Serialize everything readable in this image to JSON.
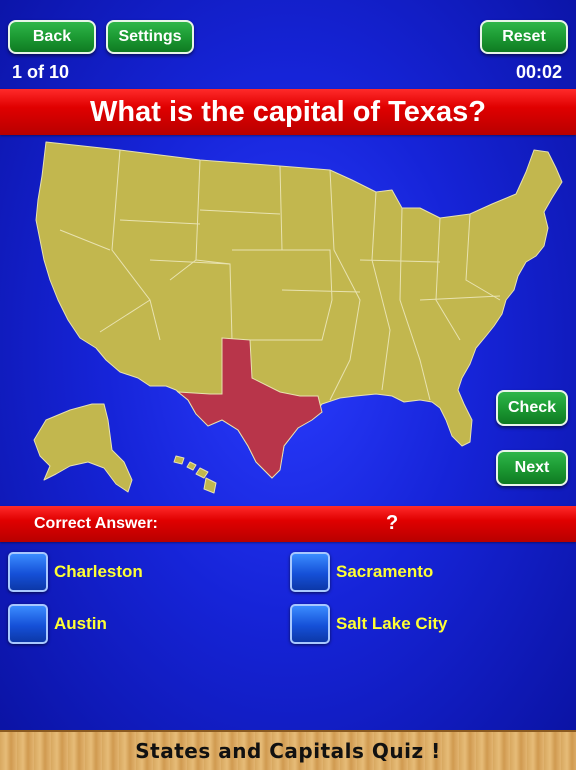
{
  "toolbar": {
    "back_label": "Back",
    "settings_label": "Settings",
    "reset_label": "Reset"
  },
  "progress": {
    "counter": "1 of 10",
    "timer": "00:02"
  },
  "question": {
    "text": "What is the capital of Texas?"
  },
  "map": {
    "highlighted_state": "Texas",
    "land_color": "#c2b74e",
    "highlight_color": "#b8354a",
    "border_color": "#e8e2b0"
  },
  "actions": {
    "check_label": "Check",
    "next_label": "Next"
  },
  "answer": {
    "label": "Correct Answer:",
    "value": "?"
  },
  "options": [
    {
      "label": "Charleston"
    },
    {
      "label": "Sacramento"
    },
    {
      "label": "Austin"
    },
    {
      "label": "Salt Lake City"
    }
  ],
  "footer": {
    "title": "States and Capitals Quiz !"
  }
}
